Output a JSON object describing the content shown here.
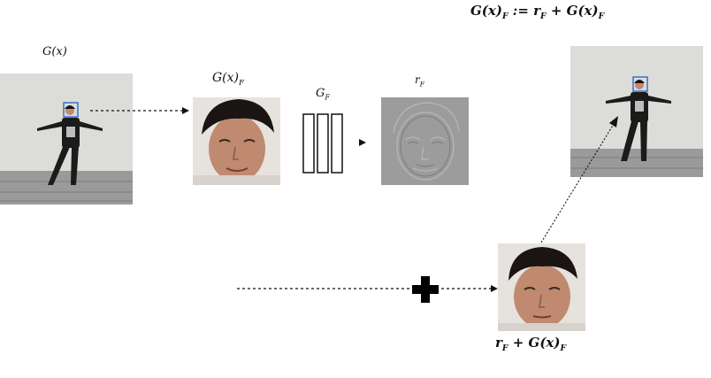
{
  "labels": {
    "top_formula": {
      "lhs": "G(x)",
      "lhs_sub": "F",
      "op": " := r",
      "op_sub": "F",
      "rhs": " + G(x)",
      "rhs_sub": "F"
    },
    "input": {
      "text": "G(x)"
    },
    "face_crop": {
      "text": "G(x)",
      "sub": "F"
    },
    "network": {
      "text": "G",
      "sub": "F"
    },
    "residual": {
      "text": "r",
      "sub": "F"
    },
    "sum": {
      "a": "r",
      "a_sub": "F",
      "b": " + G(x)",
      "b_sub": "F"
    }
  },
  "colors": {
    "background": "#ffffff",
    "bbox": "#3a6fd0",
    "arrow": "#111111",
    "plus": "#000000",
    "wall": "#dcdcd8",
    "pavement": "#9a9a9a",
    "skin": "#c08a70",
    "hair": "#1a1412",
    "residual_gray": "#9c9c9c"
  },
  "icons": {
    "plus": "plus-icon",
    "arrow": "arrow-head-icon"
  }
}
